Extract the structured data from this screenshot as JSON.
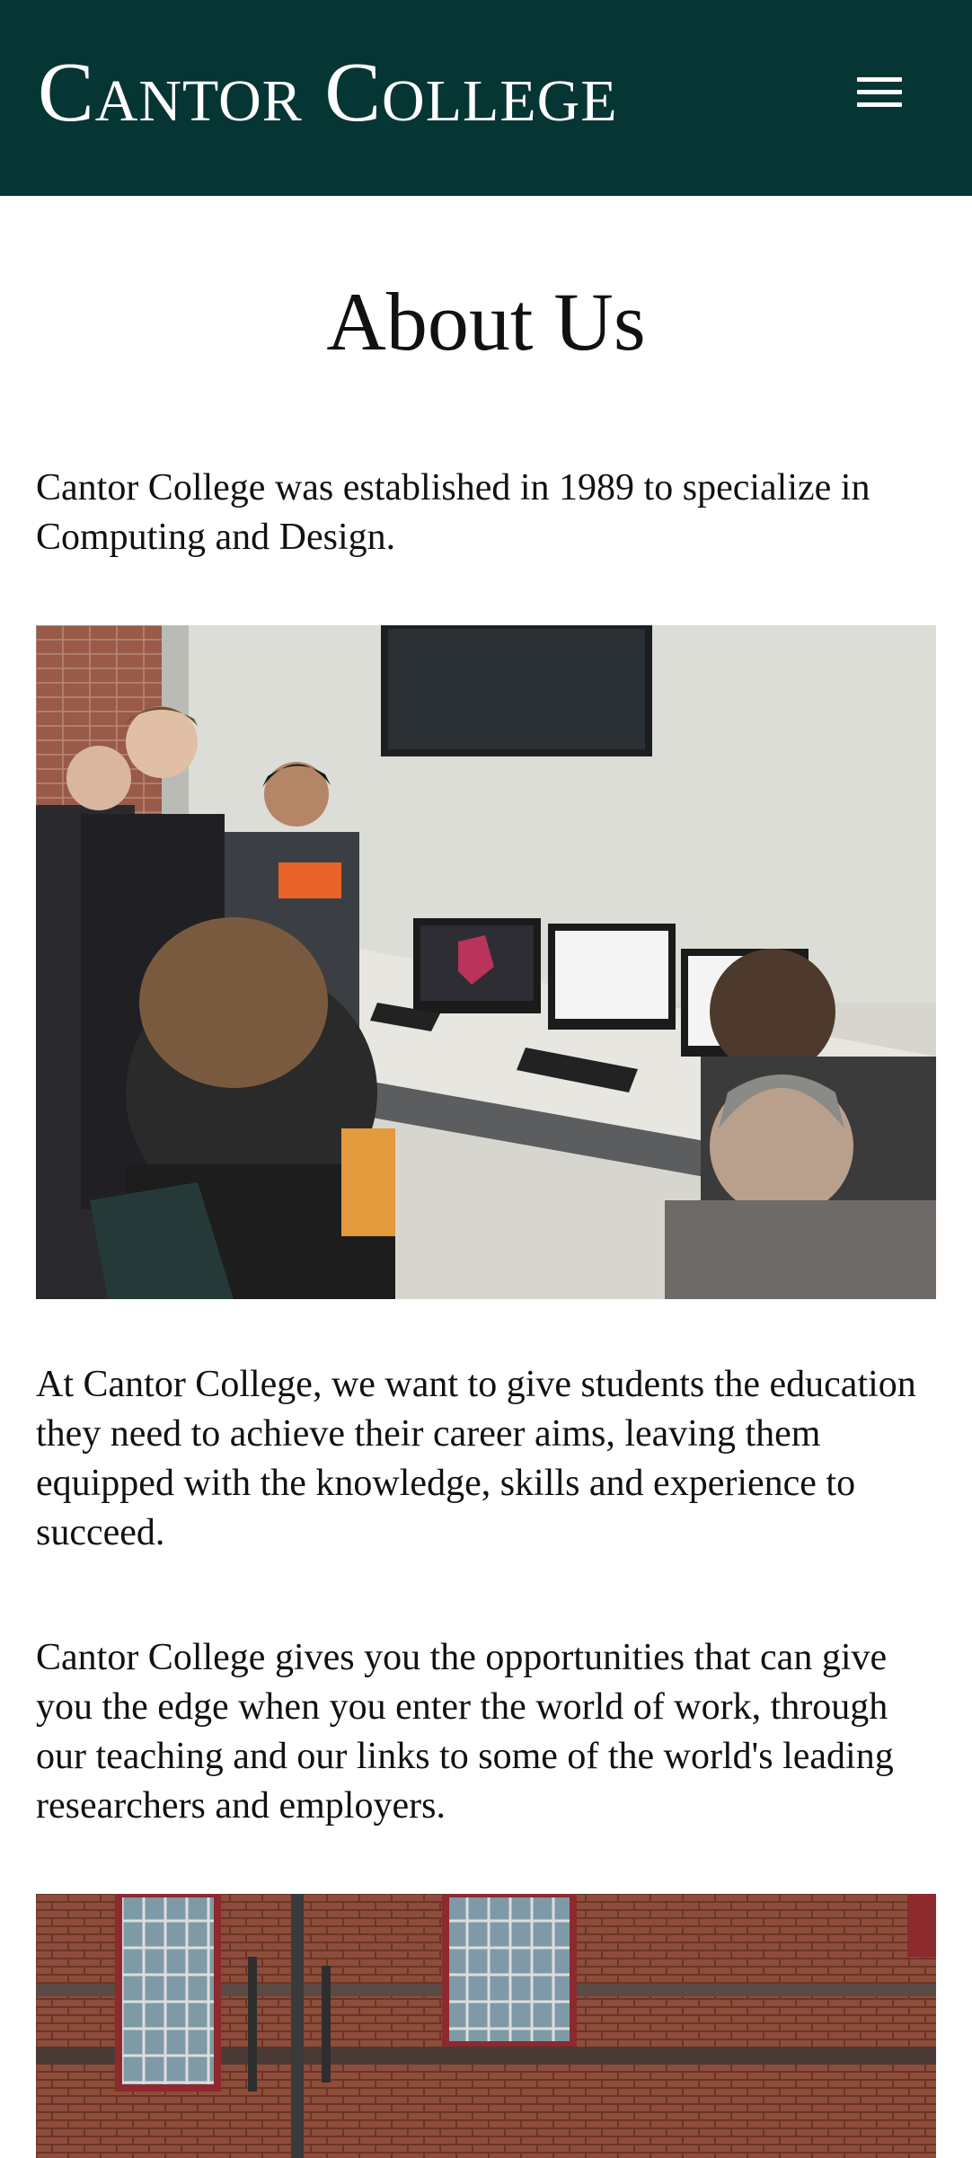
{
  "header": {
    "brand": "Cantor College",
    "menu_icon": "hamburger-menu-icon"
  },
  "main": {
    "title": "About Us",
    "intro": "Cantor College was established in 1989 to specialize in Computing and Design.",
    "paragraph_2": "At Cantor College, we want to give students the education they need to achieve their career aims, leaving them equipped with the knowledge, skills and experience to succeed.",
    "paragraph_3": "Cantor College gives you the opportunities that can give you the edge when you enter the world of work, through our teaching and our links to some of the world's leading researchers and employers."
  },
  "colors": {
    "header_bg": "#063633",
    "header_text": "#ffffff",
    "body_text": "#111111",
    "page_bg": "#ffffff"
  }
}
